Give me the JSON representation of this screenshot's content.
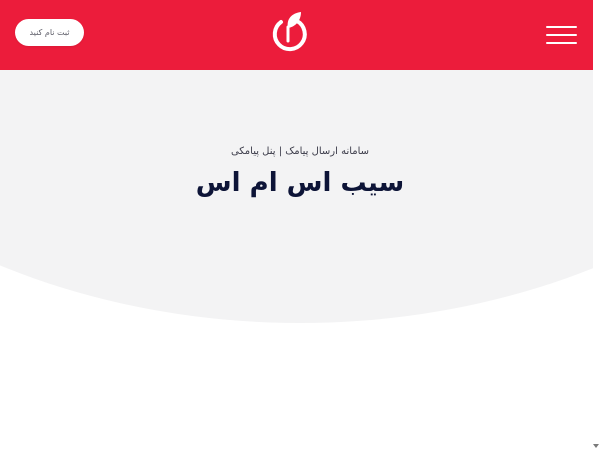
{
  "header": {
    "signup_label": "ثبت نام کنید",
    "logo_icon": "apple-leaf-logo-icon",
    "menu_icon": "hamburger-menu-icon"
  },
  "hero": {
    "subtitle": "سامانه ارسال پیامک | پنل پیامکی",
    "title": "سیب اس ام اس"
  },
  "colors": {
    "brand_red": "#ec1c3b",
    "hero_bg": "#f3f3f4",
    "title_navy": "#0d1437",
    "button_bg": "#ffffff"
  }
}
